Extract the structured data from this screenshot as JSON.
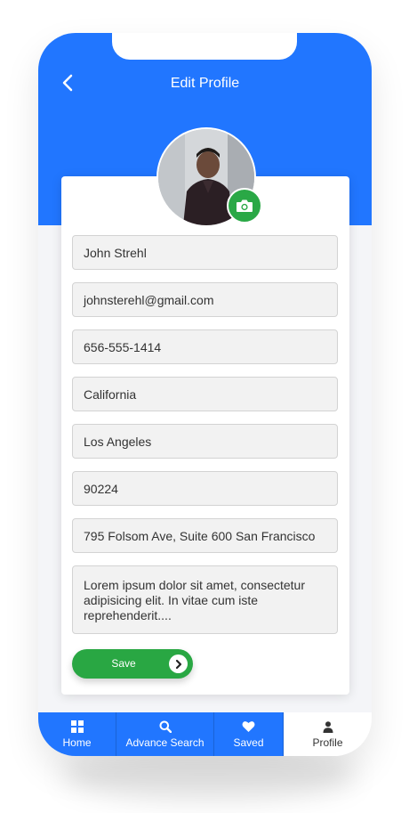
{
  "header": {
    "title": "Edit Profile"
  },
  "profile": {
    "name": "John Strehl",
    "email": "johnsterehl@gmail.com",
    "phone": "656-555-1414",
    "state": "California",
    "city": "Los Angeles",
    "zip": "90224",
    "address": "795 Folsom Ave, Suite 600 San Francisco",
    "bio": "Lorem ipsum dolor sit amet, consectetur adipisicing elit. In vitae cum iste reprehenderit...."
  },
  "actions": {
    "save_label": "Save"
  },
  "bottom_nav": {
    "items": [
      {
        "label": "Home",
        "icon": "home-grid-icon"
      },
      {
        "label": "Advance Search",
        "icon": "search-icon"
      },
      {
        "label": "Saved",
        "icon": "heart-icon"
      },
      {
        "label": "Profile",
        "icon": "user-icon"
      }
    ],
    "active": "Profile"
  },
  "colors": {
    "primary": "#2176ff",
    "accent_green": "#2aa846",
    "field_bg": "#f2f2f2",
    "page_bg": "#f4f5f8"
  }
}
